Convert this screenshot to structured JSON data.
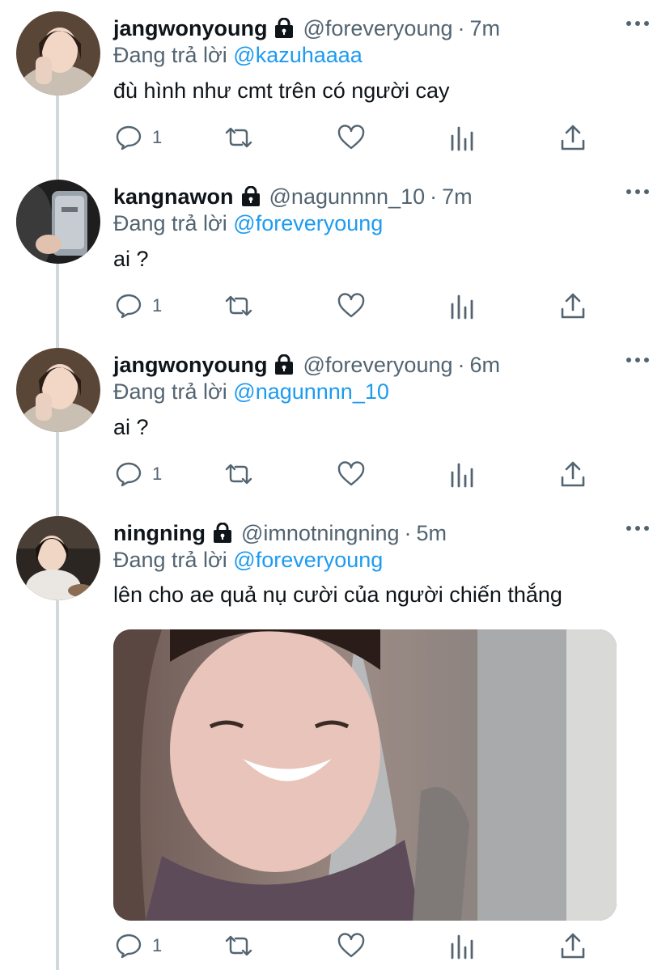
{
  "reply_prefix": "Đang trả lời",
  "tweets": [
    {
      "name": "jangwonyoung",
      "handle": "@foreveryoung",
      "time": "7m",
      "reply_to": "@kazuhaaaa",
      "text": "đù hình như cmt trên có người cay",
      "reply_count": "1"
    },
    {
      "name": "kangnawon",
      "handle": "@nagunnnn_10",
      "time": "7m",
      "reply_to": "@foreveryoung",
      "text": "ai ?",
      "reply_count": "1"
    },
    {
      "name": "jangwonyoung",
      "handle": "@foreveryoung",
      "time": "6m",
      "reply_to": "@nagunnnn_10",
      "text": "ai ?",
      "reply_count": "1"
    },
    {
      "name": "ningning",
      "handle": "@imnotningning",
      "time": "5m",
      "reply_to": "@foreveryoung",
      "text": "lên cho ae quả nụ cười của người chiến thắng",
      "reply_count": "1"
    }
  ],
  "icons": [
    "lock-icon",
    "more-icon",
    "reply-icon",
    "retweet-icon",
    "like-icon",
    "analytics-icon",
    "share-icon"
  ],
  "colors": {
    "accent": "#1d9bf0",
    "secondary_text": "#536471",
    "primary_text": "#0f1419",
    "thread_line": "#cfd9de"
  }
}
